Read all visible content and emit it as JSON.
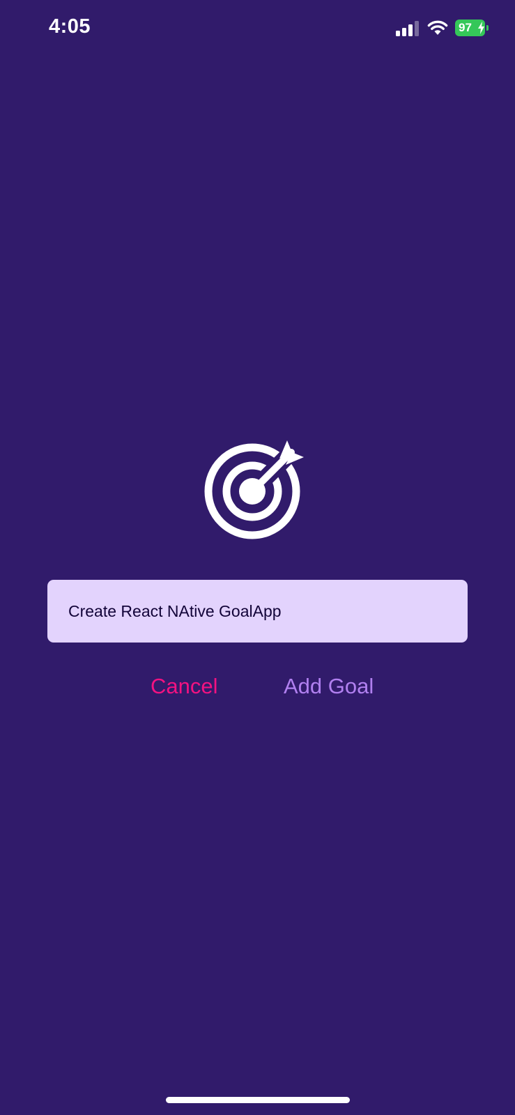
{
  "status_bar": {
    "time": "4:05",
    "battery_level": "97",
    "battery_charging": true,
    "signal_icon": "cellular-signal-icon",
    "wifi_icon": "wifi-icon",
    "battery_color": "#35c759"
  },
  "goal_image": {
    "icon": "target-arrow-icon"
  },
  "goal_input": {
    "value": "Create React NAtive GoalApp"
  },
  "buttons": {
    "cancel_label": "Cancel",
    "add_label": "Add Goal"
  },
  "colors": {
    "background": "#311b6b",
    "input_background": "#e3d3fd",
    "input_text": "#120438",
    "cancel": "#f31281",
    "add": "#b180f0"
  }
}
